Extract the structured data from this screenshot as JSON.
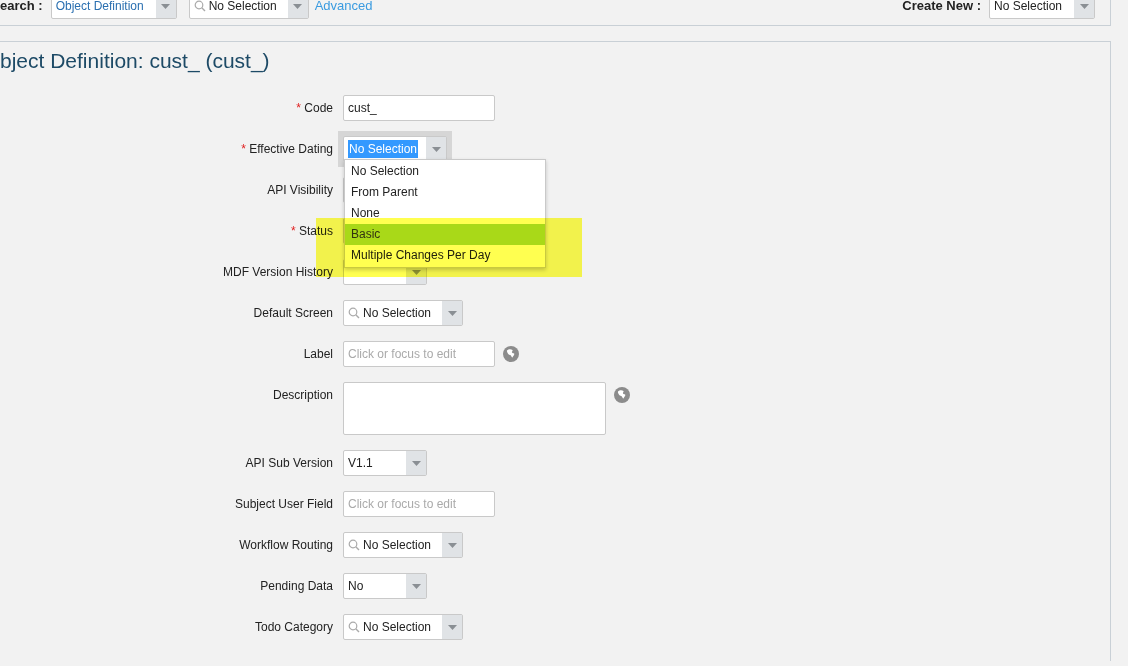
{
  "top_bar": {
    "search_label": "earch :",
    "search_type": {
      "value": "Object Definition"
    },
    "search_field": {
      "value": "No Selection"
    },
    "advanced_link": "Advanced",
    "create_new_label": "Create New :",
    "create_new": {
      "value": "No Selection"
    }
  },
  "title": "bject Definition: cust_ (cust_)",
  "fields": [
    {
      "label": "Code",
      "required_mark": "*",
      "kind": "input",
      "value": "cust_"
    },
    {
      "label": "Effective Dating",
      "required_mark": "*",
      "kind": "select",
      "value": "No Selection",
      "focused": true
    },
    {
      "label": "API Visibility",
      "kind": "select"
    },
    {
      "label": "Status",
      "required_mark": "*",
      "kind": "select"
    },
    {
      "label": "MDF Version History",
      "kind": "select"
    },
    {
      "label": "Default Screen",
      "kind": "search_select",
      "value": "No Selection"
    },
    {
      "label": "Label",
      "kind": "input",
      "placeholder": "Click or focus to edit",
      "translate_icon": true
    },
    {
      "label": "Description",
      "kind": "textarea",
      "translate_icon": true
    },
    {
      "label": "API Sub Version",
      "kind": "select",
      "value": "V1.1"
    },
    {
      "label": "Subject User Field",
      "kind": "input",
      "placeholder": "Click or focus to edit"
    },
    {
      "label": "Workflow Routing",
      "kind": "search_select",
      "value": "No Selection"
    },
    {
      "label": "Pending Data",
      "kind": "select",
      "value": "No"
    },
    {
      "label": "Todo Category",
      "kind": "search_select",
      "value": "No Selection"
    }
  ],
  "dropdown": {
    "options": [
      {
        "label": "No Selection",
        "selected": false
      },
      {
        "label": "From Parent",
        "selected": false
      },
      {
        "label": "None",
        "selected": false
      },
      {
        "label": "Basic",
        "selected": true
      },
      {
        "label": "Multiple Changes Per Day",
        "selected": false
      }
    ]
  }
}
